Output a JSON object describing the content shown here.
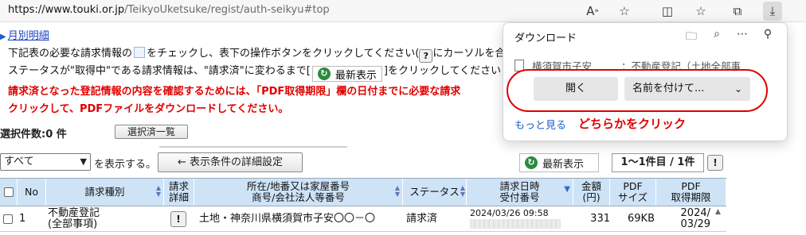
{
  "browser": {
    "url_host": "https://www.touki.or.jp",
    "url_path": "/TeikyoUketsuke/regist/auth-seikyu#top",
    "icons": [
      "read-aloud-icon",
      "favorite-star-icon",
      "split-screen-icon",
      "favorites-icon",
      "collections-icon",
      "download-icon"
    ]
  },
  "page": {
    "monthly_link": "月別明細",
    "instr1_a": "下記表の必要な請求情報の",
    "instr1_b": "をチェックし、表下の操作ボタンをクリックしてください(",
    "instr1_c": "にカーソルを合わ",
    "instr2_a": "ステータスが\"取得中\"である請求情報は、\"請求済\"に変わるまで[",
    "instr2_b": "]をクリックしてください",
    "refresh_label": "最新表示",
    "red1": "請求済となった登記情報の内容を確認するためには、「PDF取得期限」欄の日付までに必要な請求",
    "red2": "クリックして、PDFファイルをダウンロードしてください。",
    "selected_count": "選択件数:0 件",
    "selected_list_button": "選択済一覧",
    "filter_select": "すべて",
    "filter_label": "を表示する。",
    "detail_button": "← 表示条件の詳細設定",
    "count_text": "1〜1件目 / 1件",
    "info_button": "!"
  },
  "table": {
    "headers": [
      "No",
      "請求種別",
      "請求\n詳細",
      "所在/地番又は家屋番号\n商号/会社法人等番号",
      "ステータス",
      "請求日時\n受付番号",
      "金額\n(円)",
      "PDF\nサイズ",
      "PDF\n取得期限"
    ],
    "row": {
      "no": "1",
      "type": "不動産登記\n(全部事項)",
      "detail": "!",
      "location": "土地・神奈川県横須賀市子安〇〇－〇",
      "status": "請求済",
      "date": "2024/03/26 09:58",
      "amount": "331",
      "size": "69KB",
      "deadline": "2024/\n03/29"
    }
  },
  "download_panel": {
    "title": "ダウンロード",
    "file_name": "横須賀市子安",
    "file_name2": "：不動産登記（土地全部事",
    "open_button": "開く",
    "save_as_button": "名前を付けて...",
    "more_link": "もっと見る",
    "annotation": "どちらかをクリック"
  }
}
